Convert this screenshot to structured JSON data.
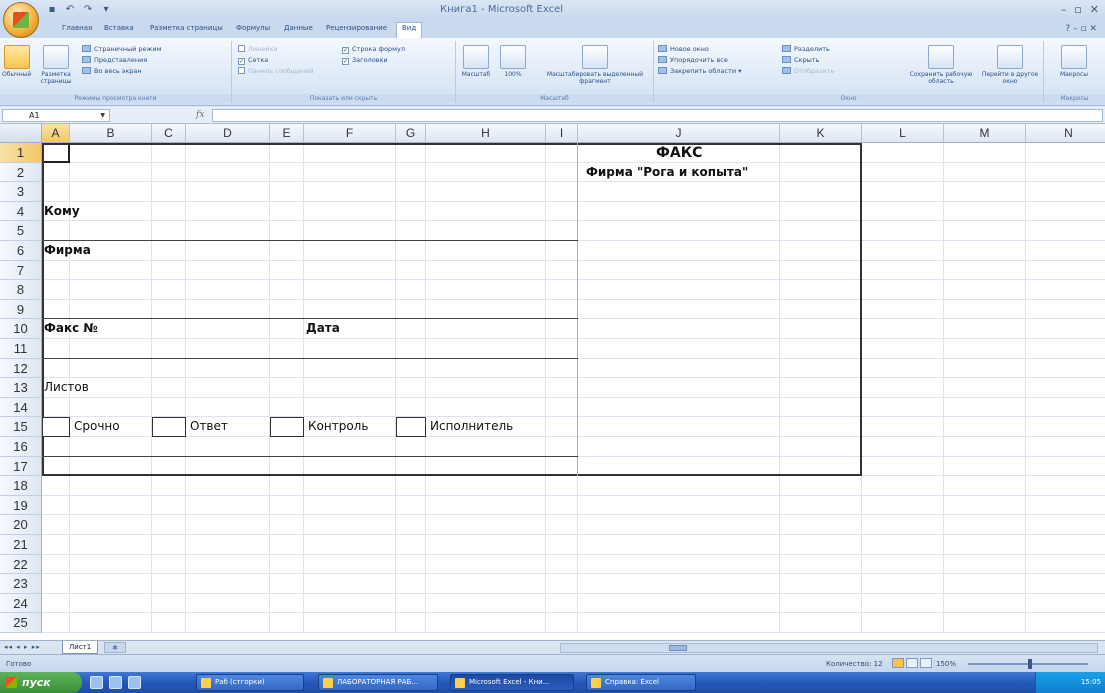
{
  "window": {
    "title": "Книга1 - Microsoft Excel"
  },
  "qat": {
    "save_icon": "save-icon",
    "undo_icon": "undo-icon",
    "redo_icon": "redo-icon"
  },
  "ribbon_tabs": [
    "Главная",
    "Вставка",
    "Разметка страницы",
    "Формулы",
    "Данные",
    "Рецензирование",
    "Вид"
  ],
  "ribbon": {
    "groups": {
      "views": {
        "label": "Режимы просмотра книги",
        "normal": "Обычный",
        "page_layout": "Разметка страницы",
        "page_break": "Страничный режим",
        "custom_views": "Представления",
        "full_screen": "Во весь экран"
      },
      "show": {
        "label": "Показать или скрыть",
        "ruler": "Линейка",
        "gridlines": "Сетка",
        "message_bar": "Панель сообщений",
        "formula_bar": "Строка формул",
        "headings": "Заголовки"
      },
      "zoom": {
        "label": "Масштаб",
        "zoom": "Масштаб",
        "zoom100": "100%",
        "zoom_sel": "Масштабировать выделенный фрагмент"
      },
      "window": {
        "label": "Окно",
        "new_window": "Новое окно",
        "arrange": "Упорядочить все",
        "freeze": "Закрепить области",
        "split": "Разделить",
        "hide": "Скрыть",
        "unhide": "Отобразить",
        "save_ws": "Сохранить рабочую область",
        "switch": "Перейти в другое окно"
      },
      "macros": {
        "label": "Макросы",
        "macros": "Макросы"
      }
    }
  },
  "formula_bar": {
    "name_box": "A1",
    "fx": "fx",
    "value": ""
  },
  "columns": [
    "A",
    "B",
    "C",
    "D",
    "E",
    "F",
    "G",
    "H",
    "I",
    "J",
    "K",
    "L",
    "M",
    "N"
  ],
  "rows": [
    "1",
    "2",
    "3",
    "4",
    "5",
    "6",
    "7",
    "8",
    "9",
    "10",
    "11",
    "12",
    "13",
    "14",
    "15",
    "16",
    "17",
    "18",
    "19",
    "20",
    "21",
    "22",
    "23",
    "24",
    "25"
  ],
  "cells": {
    "fax_title": "ФАКС",
    "firm_name": "Фирма \"Рога и копыта\"",
    "to_label": "Кому",
    "firm_label": "Фирма",
    "fax_no_label": "Факс №",
    "date_label": "Дата",
    "sheets_label": "Листов",
    "urgent": "Срочно",
    "reply": "Ответ",
    "control": "Контроль",
    "executor": "Исполнитель"
  },
  "sheet_tabs": {
    "active": "Лист1"
  },
  "status_bar": {
    "ready": "Готово",
    "count": "Количество: 12",
    "zoom": "150%"
  },
  "taskbar": {
    "start": "пуск",
    "tasks": [
      "Раб (стгорки)",
      "ЛАБОРАТОРНАЯ РАБ...",
      "Microsoft Excel - Кни...",
      "Справка: Excel"
    ],
    "clock": "15:05"
  }
}
